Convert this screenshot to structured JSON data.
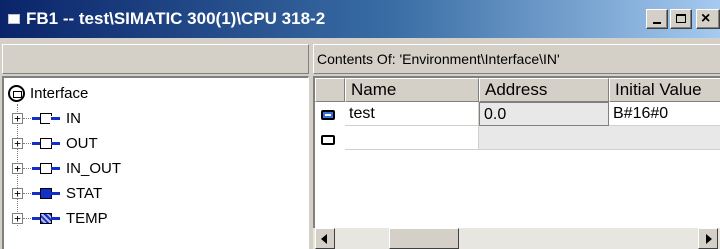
{
  "window": {
    "title": "FB1 -- test\\SIMATIC 300(1)\\CPU 318-2",
    "close_glyph": "×"
  },
  "left_pane": {
    "root": {
      "label": "Interface",
      "icon": "interface-root-icon"
    },
    "expander_glyph": "+",
    "items": [
      {
        "label": "IN",
        "icon": "in-icon",
        "fill_color": "#ffffff"
      },
      {
        "label": "OUT",
        "icon": "out-icon",
        "fill_color": "#ffffff"
      },
      {
        "label": "IN_OUT",
        "icon": "in-out-icon",
        "fill_color": "#ffffff"
      },
      {
        "label": "STAT",
        "icon": "stat-icon",
        "fill_color": "#1230c8"
      },
      {
        "label": "TEMP",
        "icon": "temp-icon",
        "fill_color": "#8a8ad8"
      }
    ]
  },
  "right_pane": {
    "header": "Contents Of: 'Environment\\Interface\\IN'",
    "columns": [
      "Name",
      "Address",
      "Initial Value"
    ],
    "rows": [
      {
        "name": "test",
        "address": "0.0",
        "initial_value": "B#16#0",
        "icon": "parameter-icon"
      },
      {
        "name": "",
        "address": "",
        "initial_value": "",
        "icon": "new-parameter-icon"
      }
    ]
  },
  "scrollbar": {
    "position": 0.18
  },
  "colors": {
    "title_gradient_start": "#0a246a",
    "title_gradient_end": "#a6caf0",
    "face": "#d4d0c8",
    "pin_blue": "#1230c8"
  }
}
